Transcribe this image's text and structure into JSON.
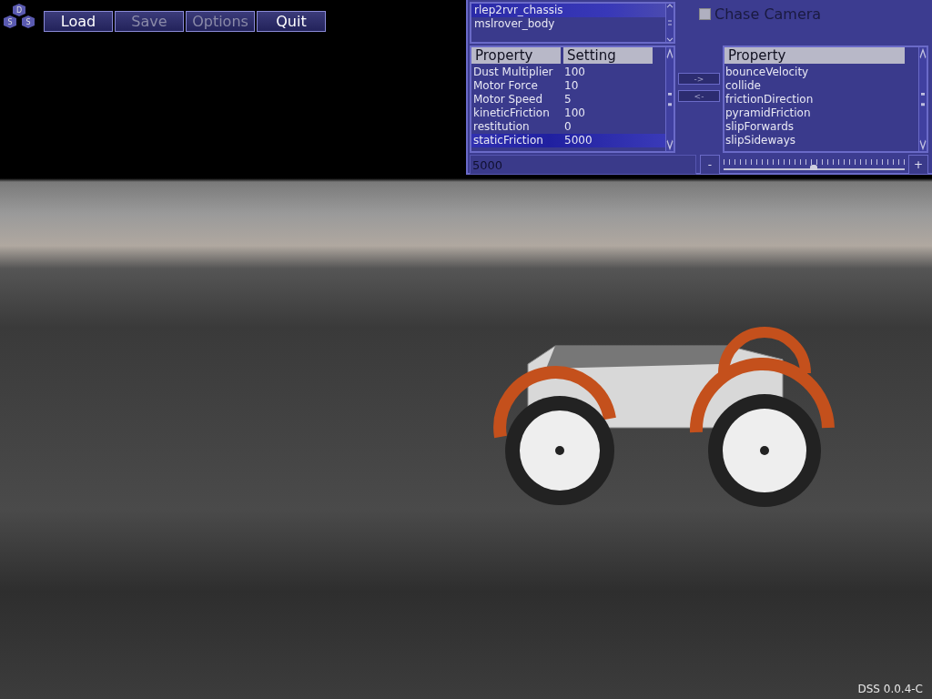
{
  "logo": {
    "letters": [
      "D",
      "S",
      "S"
    ]
  },
  "toolbar": [
    {
      "label": "Load",
      "disabled": false
    },
    {
      "label": "Save",
      "disabled": true
    },
    {
      "label": "Options",
      "disabled": true
    },
    {
      "label": "Quit",
      "disabled": false
    }
  ],
  "body_list": [
    {
      "label": "rlep2rvr_chassis",
      "selected": true
    },
    {
      "label": "mslrover_body",
      "selected": false
    }
  ],
  "chase_camera": {
    "label": "Chase Camera",
    "checked": false
  },
  "property_table": {
    "columns": [
      "Property",
      "Setting"
    ],
    "rows": [
      {
        "property": "Dust Multiplier",
        "setting": "100",
        "selected": false
      },
      {
        "property": "Motor Force",
        "setting": "10",
        "selected": false
      },
      {
        "property": "Motor Speed",
        "setting": "5",
        "selected": false
      },
      {
        "property": "kineticFriction",
        "setting": "100",
        "selected": false
      },
      {
        "property": "restitution",
        "setting": "0",
        "selected": false
      },
      {
        "property": "staticFriction",
        "setting": "5000",
        "selected": true
      }
    ]
  },
  "move_buttons": [
    "->",
    "<-"
  ],
  "available_properties": {
    "column": "Property",
    "items": [
      "bounceVelocity",
      "collide",
      "frictionDirection",
      "pyramidFriction",
      "slipForwards",
      "slipSideways"
    ]
  },
  "value_field": {
    "value": "5000"
  },
  "decrement_button": "-",
  "increment_button": "+",
  "value_slider": {
    "level": 0.5
  },
  "version": "DSS 0.0.4-C"
}
